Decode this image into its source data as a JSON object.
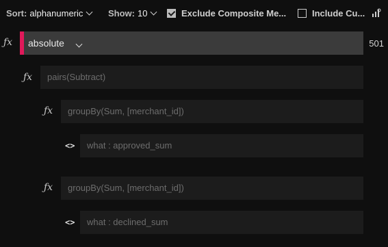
{
  "toolbar": {
    "sort_label": "Sort:",
    "sort_value": "alphanumeric",
    "show_label": "Show:",
    "show_value": "10",
    "exclude_label": "Exclude Composite Me...",
    "exclude_checked": true,
    "include_label": "Include Cu...",
    "include_checked": false,
    "icons": [
      "chevron-down-icon",
      "checkbox-icon",
      "chart-settings-icon"
    ]
  },
  "tree": {
    "root": {
      "icon": "function-icon",
      "label": "absolute",
      "count": "501"
    },
    "level1": {
      "icon": "function-icon",
      "label": "pairs(Subtract)"
    },
    "group1": {
      "icon": "function-icon",
      "label": "groupBy(Sum, [merchant_id])",
      "child": {
        "icon": "code-icon",
        "label": "what : approved_sum"
      }
    },
    "group2": {
      "icon": "function-icon",
      "label": "groupBy(Sum, [merchant_id])",
      "child": {
        "icon": "code-icon",
        "label": "what : declined_sum"
      }
    }
  },
  "glyphs": {
    "fx": "ƒx",
    "code": "<>"
  },
  "colors": {
    "background": "#0f0f0f",
    "root_node": "#3b3b3b",
    "accent": "#e0195a",
    "node": "#1c1c1c"
  }
}
